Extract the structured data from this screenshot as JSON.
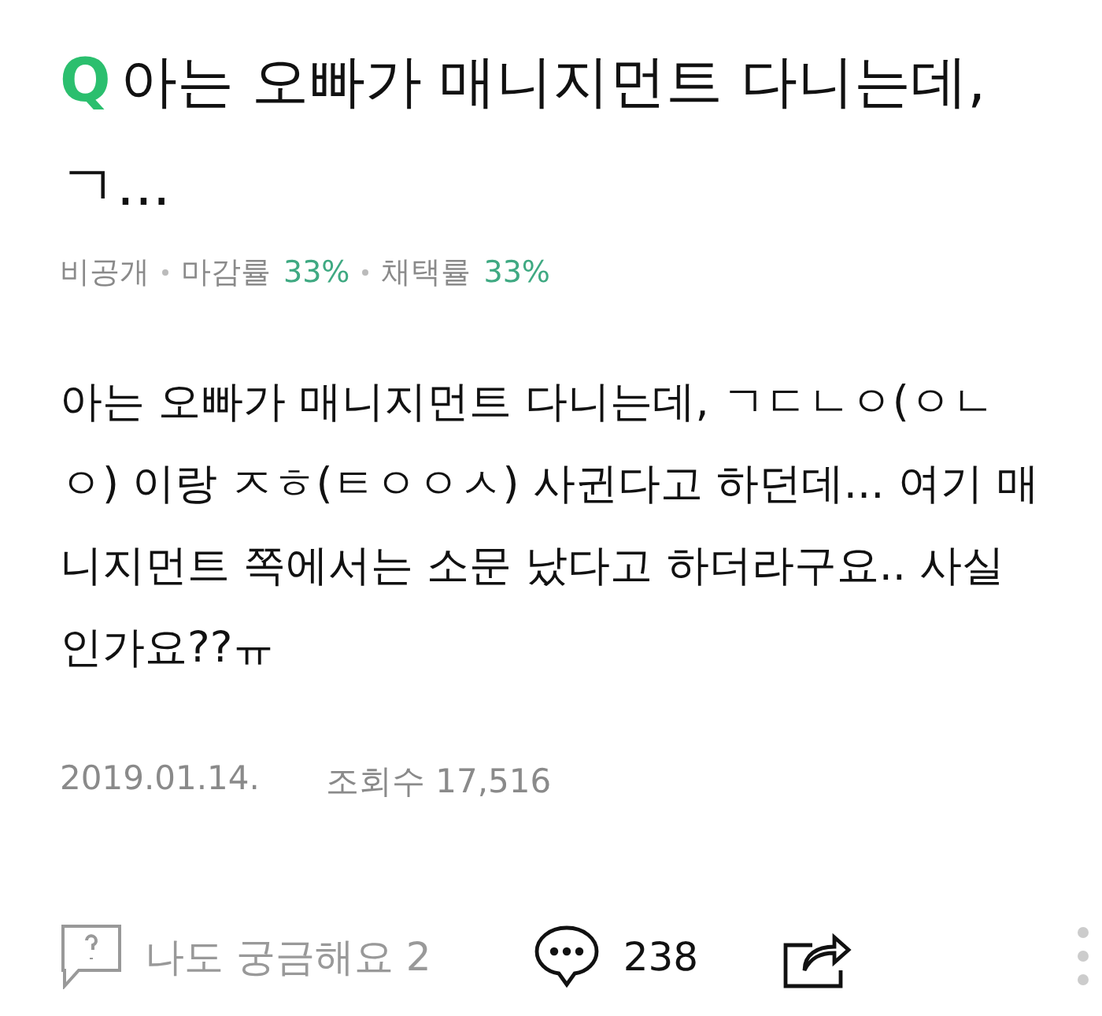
{
  "question": {
    "badge": "Q",
    "title": "아는 오빠가 매니지먼트 다니는데, ㄱ..."
  },
  "meta": {
    "visibility": "비공개",
    "rates": [
      {
        "label": "마감률",
        "value": "33%"
      },
      {
        "label": "채택률",
        "value": "33%"
      }
    ]
  },
  "body": "아는 오빠가 매니지먼트 다니는데, ㄱㄷㄴㅇ(ㅇㄴㅇ) 이랑 ㅈㅎ(ㅌㅇㅇㅅ) 사귄다고 하던데... 여기 매니지먼트 쪽에서는 소문 났다고 하더라구요.. 사실 인가요??ㅠ",
  "date": "2019.01.14.",
  "views": "조회수 17,516",
  "actions": {
    "curious": "나도 궁금해요 2",
    "comments": "238"
  }
}
